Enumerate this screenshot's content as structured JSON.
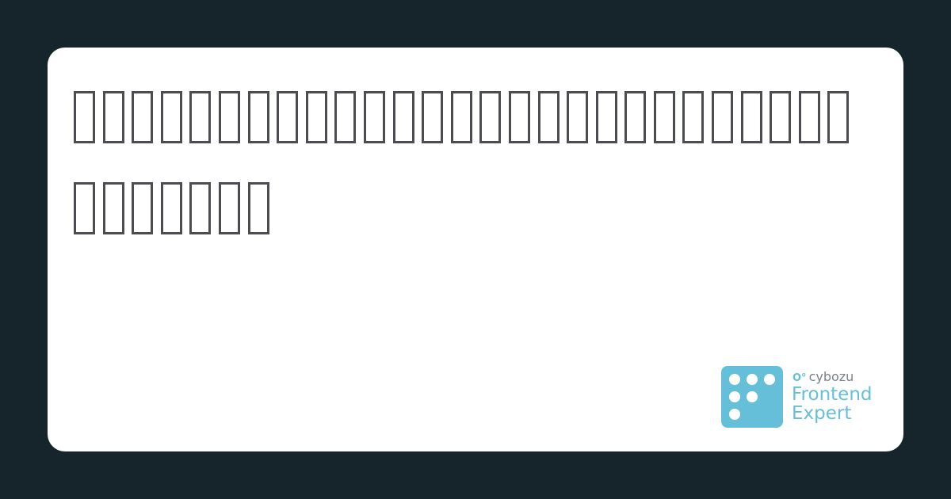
{
  "title": "□□□□□□□□□□□□□□□□□□□□□□□□□□□□□□□□□□",
  "logo": {
    "company": "cybozu",
    "line1": "Frontend",
    "line2": "Expert",
    "color": "#65bfd9"
  }
}
